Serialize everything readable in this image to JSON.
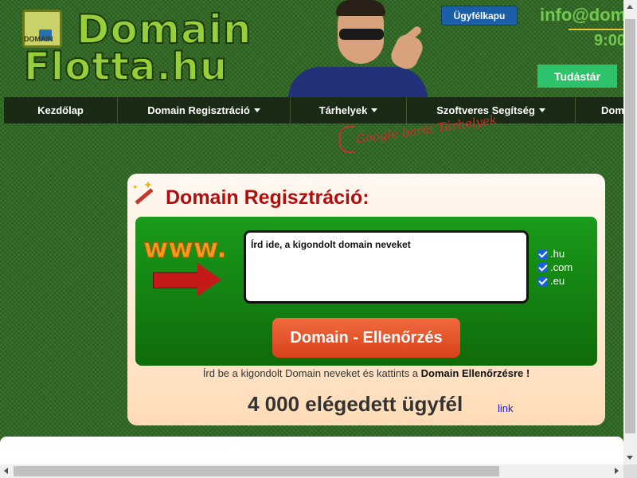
{
  "header": {
    "logo_line1": "Domain",
    "logo_line2": "Flotta.hu",
    "logo_badge": "DOMAIN",
    "client_portal_label": "Ügyfélkapu",
    "email_partial": "info@dom",
    "hours_partial": "9:00",
    "knowledge_base_label": "Tudástár"
  },
  "nav": {
    "items": [
      {
        "label": "Kezdőlap",
        "has_dropdown": false
      },
      {
        "label": "Domain Regisztráció",
        "has_dropdown": true
      },
      {
        "label": "Tárhelyek",
        "has_dropdown": true
      },
      {
        "label": "Szoftveres Segítség",
        "has_dropdown": true
      },
      {
        "label": "Dom",
        "has_dropdown": false
      }
    ]
  },
  "promo_note": "Google barát Tárhelyek",
  "domain_form": {
    "title": "Domain Regisztráció:",
    "www_text": "www.",
    "input_placeholder": "Írd ide, a kigondolt domain neveket",
    "tlds": [
      {
        "label": ".hu",
        "checked": true
      },
      {
        "label": ".com",
        "checked": true
      },
      {
        "label": ".eu",
        "checked": true
      }
    ],
    "check_button_label": "Domain - Ellenőrzés",
    "help_prefix": "Írd be a kigondolt Domain neveket és kattints a ",
    "help_bold": "Domain Ellenőrzésre !",
    "customers_text": "4 000 elégedett ügyfél",
    "link_label": "link"
  },
  "colors": {
    "background": "#2f6a22",
    "nav_bg": "#1b2a14",
    "title_red": "#b20d0d",
    "panel_green": "#1a9b1a",
    "button_orange": "#e85a30",
    "portal_blue": "#1a5fa8",
    "knowledge_green": "#2ec26a"
  }
}
